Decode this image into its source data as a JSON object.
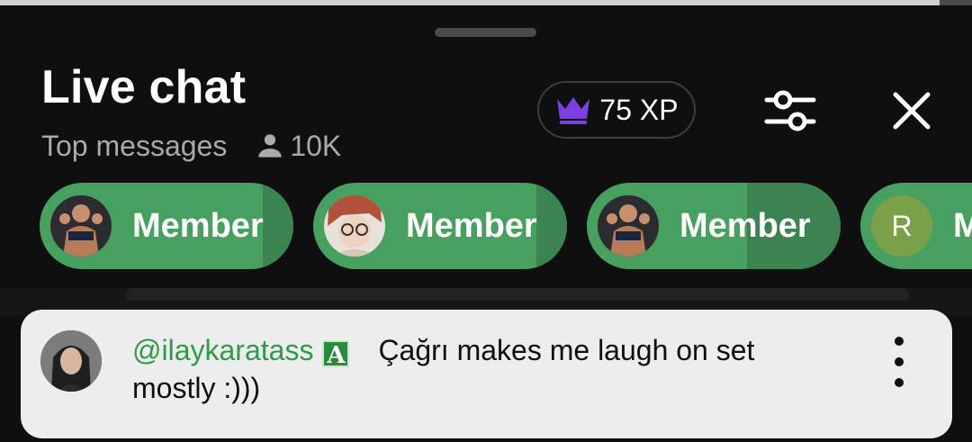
{
  "header": {
    "title": "Live chat",
    "mode": "Top messages",
    "viewer_count": "10K",
    "xp_label": "75 XP",
    "icons": {
      "viewers": "person-icon",
      "xp": "crown-icon",
      "filter": "sliders-icon",
      "close": "close-icon"
    }
  },
  "chips": [
    {
      "label": "Member",
      "avatar": "photo"
    },
    {
      "label": "Member",
      "avatar": "photo"
    },
    {
      "label": "Member",
      "avatar": "photo"
    },
    {
      "label": "M",
      "avatar_letter": "R"
    }
  ],
  "pinned_message": {
    "author": "@ilaykaratass",
    "badge": "A",
    "text": "Çağrı makes me laugh on set mostly :)))"
  },
  "colors": {
    "background": "#0f0f0f",
    "chip_green": "#48a060",
    "author_green": "#2f9a4a",
    "crown_purple": "#7b3fe4",
    "card_bg": "#ededed"
  }
}
